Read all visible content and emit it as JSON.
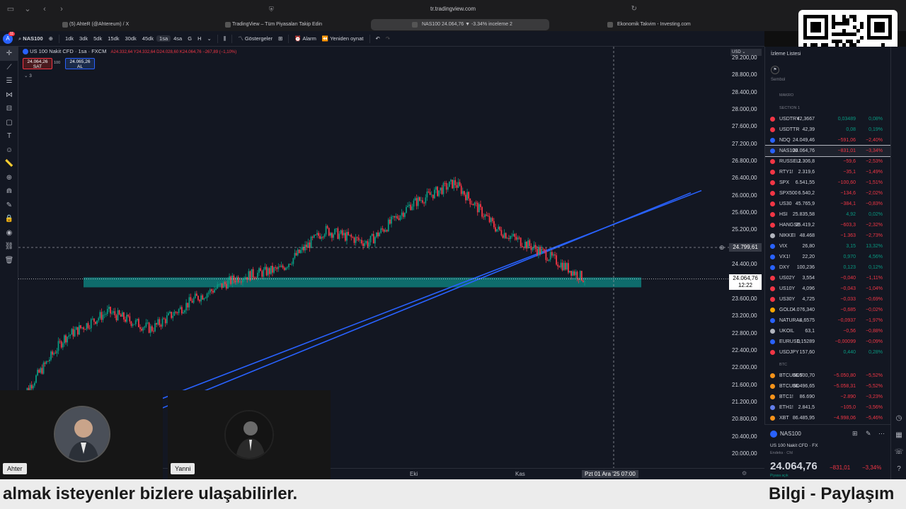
{
  "browser": {
    "url": "tr.tradingview.com",
    "tabs": [
      {
        "title": "(5) AhteR (@Ahtereum) / X",
        "active": false
      },
      {
        "title": "TradingView – Tüm Piyasaları Takip Edin",
        "active": false
      },
      {
        "title": "NAS100 24.064,76 ▼ -3.34% inceleme 2",
        "active": true
      },
      {
        "title": "Ekonomik Takvim - Investing.com",
        "active": false
      }
    ]
  },
  "toolbar": {
    "symbol": "NAS100",
    "intervals": [
      "1dk",
      "3dk",
      "5dk",
      "15dk",
      "30dk",
      "45dk",
      "1sa",
      "4sa",
      "G",
      "H"
    ],
    "selected_interval": "1sa",
    "indicators_label": "Göstergeler",
    "alarm_label": "Alarm",
    "replay_label": "Yeniden oynat",
    "notif_count": "11"
  },
  "legend": {
    "title": "US 100 Nakit CFD · 1sa · FXCM",
    "ohlc": "A24.332,64 Y24.332,64 D24.028,60 K24.064,76 −267,89 (−1,10%)",
    "bid": "24.064,26",
    "bid_label": "SAT",
    "spread": "100",
    "ask": "24.065,26",
    "ask_label": "AL",
    "indicator_count": "3"
  },
  "price_axis": {
    "currency": "USD",
    "ticks": [
      "29.200,00",
      "28.800,00",
      "28.400,00",
      "28.000,00",
      "27.600,00",
      "27.200,00",
      "26.800,00",
      "26.400,00",
      "26.000,00",
      "25.600,00",
      "25.200,00",
      "24.400,00",
      "23.600,00",
      "23.200,00",
      "22.800,00",
      "22.400,00",
      "22.000,00",
      "21.600,00",
      "21.200,00",
      "20.800,00",
      "20.400,00",
      "20.000,00"
    ],
    "crosshair_price": "24.799,61",
    "last_price": "24.064,76",
    "countdown": "12:22"
  },
  "time_axis": {
    "labels": [
      "Eki",
      "Kas"
    ],
    "crosshair_time": "Pzt 01 Ara '25  07:00"
  },
  "watchlist": {
    "title": "İzleme Listesi",
    "column_symbol": "Sembol",
    "section_makro": "MAKRO",
    "section_1": "SECTION 1",
    "section_btc": "BTC",
    "rows": [
      {
        "sym": "USDTRY",
        "last": "42,3667",
        "chg": "0,03489",
        "pct": "0,08%",
        "dir": "up",
        "color": "#f23645"
      },
      {
        "sym": "USDTTR",
        "last": "42,39",
        "chg": "0,08",
        "pct": "0,19%",
        "dir": "up",
        "color": "#f23645"
      },
      {
        "sym": "NDQ",
        "last": "24.049,46",
        "chg": "−591,06",
        "pct": "−2,40%",
        "dir": "dn",
        "color": "#2962ff"
      },
      {
        "sym": "NAS100",
        "last": "24.064,76",
        "chg": "−831,01",
        "pct": "−3,34%",
        "dir": "dn",
        "color": "#2962ff",
        "selected": true
      },
      {
        "sym": "RUSSELL",
        "last": "2.306,8",
        "chg": "−59,6",
        "pct": "−2,53%",
        "dir": "dn",
        "color": "#f23645"
      },
      {
        "sym": "RTY1!",
        "last": "2.319,6",
        "chg": "−35,1",
        "pct": "−1,49%",
        "dir": "dn",
        "color": "#f23645"
      },
      {
        "sym": "SPX",
        "last": "6.541,55",
        "chg": "−100,60",
        "pct": "−1,51%",
        "dir": "dn",
        "color": "#f23645"
      },
      {
        "sym": "SPX500",
        "last": "6.540,2",
        "chg": "−134,6",
        "pct": "−2,02%",
        "dir": "dn",
        "color": "#f23645"
      },
      {
        "sym": "US30",
        "last": "45.765,9",
        "chg": "−384,1",
        "pct": "−0,83%",
        "dir": "dn",
        "color": "#f23645"
      },
      {
        "sym": "HSI",
        "last": "25.835,58",
        "chg": "4,92",
        "pct": "0,02%",
        "dir": "up",
        "color": "#f23645"
      },
      {
        "sym": "HANGSE",
        "last": "25.419,2",
        "chg": "−603,3",
        "pct": "−2,32%",
        "dir": "dn",
        "color": "#f23645"
      },
      {
        "sym": "NIKKEI",
        "last": "48.468",
        "chg": "−1.363",
        "pct": "−2,73%",
        "dir": "dn",
        "color": "#b2b5be"
      },
      {
        "sym": "VIX",
        "last": "26,80",
        "chg": "3,15",
        "pct": "13,32%",
        "dir": "up",
        "color": "#2962ff"
      },
      {
        "sym": "VX1!",
        "last": "22,20",
        "chg": "0,970",
        "pct": "4,56%",
        "dir": "up",
        "color": "#2962ff"
      },
      {
        "sym": "DXY",
        "last": "100,236",
        "chg": "0,123",
        "pct": "0,12%",
        "dir": "up",
        "color": "#2962ff"
      },
      {
        "sym": "US02Y",
        "last": "3,554",
        "chg": "−0,040",
        "pct": "−1,11%",
        "dir": "dn",
        "color": "#f23645"
      },
      {
        "sym": "US10Y",
        "last": "4,096",
        "chg": "−0,043",
        "pct": "−1,04%",
        "dir": "dn",
        "color": "#f23645"
      },
      {
        "sym": "US30Y",
        "last": "4,725",
        "chg": "−0,033",
        "pct": "−0,69%",
        "dir": "dn",
        "color": "#f23645"
      },
      {
        "sym": "GOLD",
        "last": "4.076,340",
        "chg": "−0,685",
        "pct": "−0,02%",
        "dir": "dn",
        "color": "#f7a600"
      },
      {
        "sym": "NATURAL",
        "last": "4,6575",
        "chg": "−0,0937",
        "pct": "−1,97%",
        "dir": "dn",
        "color": "#2962ff"
      },
      {
        "sym": "UKOIL",
        "last": "63,1",
        "chg": "−0,56",
        "pct": "−0,88%",
        "dir": "dn",
        "color": "#b2b5be"
      },
      {
        "sym": "EURUSD",
        "last": "1,15289",
        "chg": "−0,00099",
        "pct": "−0,09%",
        "dir": "dn",
        "color": "#2962ff"
      },
      {
        "sym": "USDJPY",
        "last": "157,60",
        "chg": "0,440",
        "pct": "0,28%",
        "dir": "up",
        "color": "#f23645"
      },
      {
        "sym": "BTCUSDT",
        "last": "86.500,70",
        "chg": "−5.050,80",
        "pct": "−5,52%",
        "dir": "dn",
        "color": "#f7931a"
      },
      {
        "sym": "BTCUSD",
        "last": "86.496,65",
        "chg": "−5.058,31",
        "pct": "−5,52%",
        "dir": "dn",
        "color": "#f7931a"
      },
      {
        "sym": "BTC1!",
        "last": "86.690",
        "chg": "−2.890",
        "pct": "−3,23%",
        "dir": "dn",
        "color": "#f7931a"
      },
      {
        "sym": "ETH1!",
        "last": "2.841,5",
        "chg": "−105,0",
        "pct": "−3,56%",
        "dir": "dn",
        "color": "#627eea"
      },
      {
        "sym": "XBT",
        "last": "86.485,95",
        "chg": "−4.998,06",
        "pct": "−5,46%",
        "dir": "dn",
        "color": "#f7931a"
      }
    ]
  },
  "details": {
    "symbol": "NAS100",
    "name": "US 100 Nakit CFD",
    "exchange": "FX",
    "type": "Endeks",
    "sub_type": "Cfd",
    "price": "24.064,76",
    "change": "−831,01",
    "pct": "−3,34%",
    "status": "Piyasa açık"
  },
  "cams": [
    {
      "name": "Ahter"
    },
    {
      "name": "Yanni"
    }
  ],
  "ticker": {
    "left": "almak isteyenler bizlere ulaşabilirler.",
    "right": "Bilgi - Paylaşım"
  },
  "chart_data": {
    "type": "line",
    "title": "US 100 Nakit CFD · 1sa · FXCM",
    "x": [
      "Eki",
      "Kas",
      "Pzt 01 Ara '25"
    ],
    "series": [
      {
        "name": "NAS100",
        "values": [
          21300,
          22700,
          23300,
          22900,
          23600,
          24100,
          24300,
          25200,
          24900,
          25800,
          26300,
          25200,
          24700,
          24064.76
        ]
      }
    ],
    "ylim": [
      20000,
      29400
    ],
    "support_zone": [
      23950,
      24100
    ],
    "trendline_start": [
      21000,
      21150
    ],
    "trendline_end": [
      26100,
      26250
    ],
    "last_price": 24064.76
  }
}
